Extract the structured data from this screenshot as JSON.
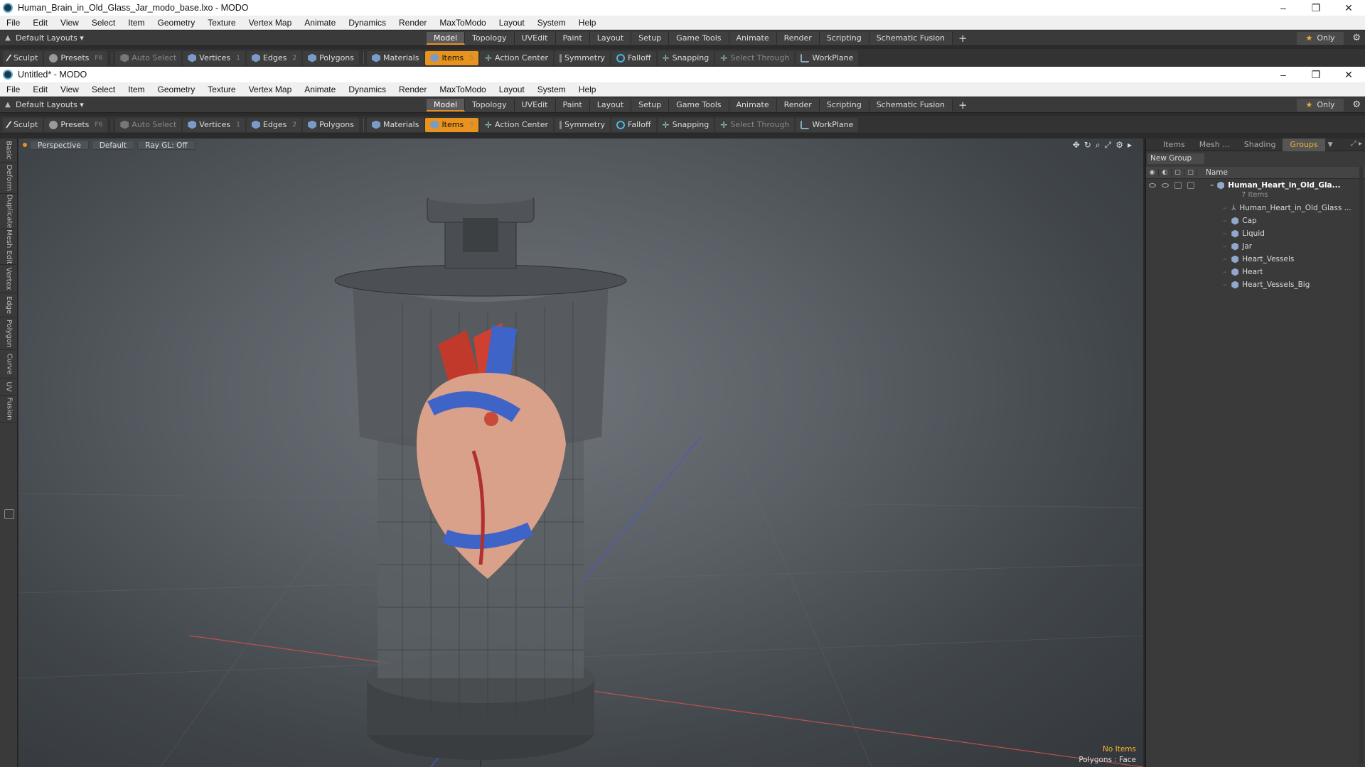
{
  "window_back": {
    "title": "Human_Brain_in_Old_Glass_Jar_modo_base.lxo - MODO",
    "controls": [
      "–",
      "❐",
      "✕"
    ]
  },
  "window_front": {
    "title": "Untitled* - MODO",
    "controls": [
      "–",
      "❐",
      "✕"
    ]
  },
  "menu": [
    "File",
    "Edit",
    "View",
    "Select",
    "Item",
    "Geometry",
    "Texture",
    "Vertex Map",
    "Animate",
    "Dynamics",
    "Render",
    "MaxToModo",
    "Layout",
    "System",
    "Help"
  ],
  "layout_bar": {
    "layouts_label": "Default Layouts ▾",
    "tabs": [
      "Model",
      "Topology",
      "UVEdit",
      "Paint",
      "Layout",
      "Setup",
      "Game Tools",
      "Animate",
      "Render",
      "Scripting",
      "Schematic Fusion"
    ],
    "active_tab": "Model",
    "add": "+",
    "only_label": "Only",
    "star": "★",
    "gear": "⚙"
  },
  "toolbar": {
    "sculpt": "Sculpt",
    "presets": "Presets",
    "presets_key": "F6",
    "auto_select": "Auto Select",
    "vertices": "Vertices",
    "vertices_key": "1",
    "edges": "Edges",
    "edges_key": "2",
    "polygons": "Polygons",
    "materials": "Materials",
    "items": "Items",
    "items_key": "5",
    "action_center": "Action Center",
    "symmetry": "Symmetry",
    "falloff": "Falloff",
    "snapping": "Snapping",
    "select_through": "Select Through",
    "workplane": "WorkPlane"
  },
  "left_tabs": [
    "Basic",
    "Deform",
    "Duplicate",
    "Mesh Edit",
    "Vertex",
    "Edge",
    "Polygon",
    "Curve",
    "UV",
    "Fusion"
  ],
  "viewport": {
    "view_mode": "Perspective",
    "shading": "Default",
    "raygl": "Ray GL: Off",
    "status_items": "No Items",
    "status_polys": "Polygons : Face",
    "tool_icons": [
      "✥",
      "↻",
      "⌕",
      "⤢",
      "⚙",
      "▸"
    ]
  },
  "right_panel": {
    "tabs": [
      "Items",
      "Mesh ...",
      "Shading",
      "Groups"
    ],
    "active_tab": "Groups",
    "new_group": "New Group",
    "col_name": "Name",
    "group": {
      "name": "Human_Heart_in_Old_Gla...",
      "count": "7 Items",
      "children": [
        {
          "name": "Human_Heart_in_Old_Glass ...",
          "icon": "locator-icon"
        },
        {
          "name": "Cap",
          "icon": "mesh-icon"
        },
        {
          "name": "Liquid",
          "icon": "mesh-icon"
        },
        {
          "name": "Jar",
          "icon": "mesh-icon"
        },
        {
          "name": "Heart_Vessels",
          "icon": "mesh-icon"
        },
        {
          "name": "Heart",
          "icon": "mesh-icon"
        },
        {
          "name": "Heart_Vessels_Big",
          "icon": "mesh-icon"
        }
      ]
    }
  },
  "colors": {
    "accent": "#e8931e",
    "highlight_text": "#f0b030"
  }
}
